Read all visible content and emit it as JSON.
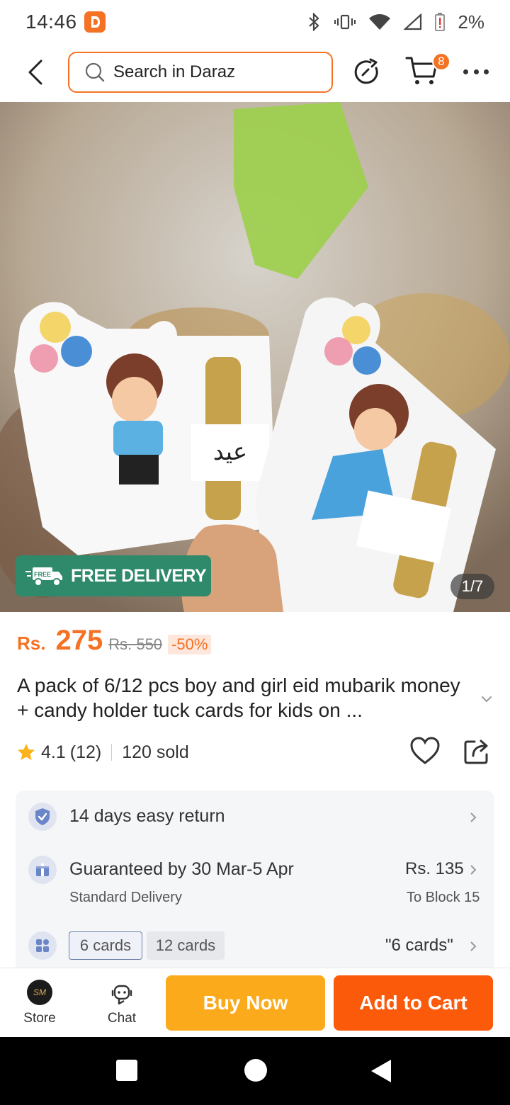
{
  "status_bar": {
    "time": "14:46",
    "battery": "2%"
  },
  "search": {
    "placeholder": "Search in Daraz"
  },
  "cart": {
    "badge_count": "8"
  },
  "product": {
    "badge": "FREE DELIVERY",
    "badge_small": "FREE",
    "image_counter": "1/7",
    "price_currency": "Rs.",
    "price": "275",
    "price_original": "Rs. 550",
    "discount": "-50%",
    "title": "A pack of 6/12 pcs  boy and  girl eid mubarik money + candy holder tuck cards for kids on ...",
    "rating": "4.1",
    "rating_count": "(12)",
    "sold": "120 sold"
  },
  "info": {
    "return_text": "14 days easy return",
    "delivery_text": "Guaranteed by 30 Mar-5 Apr",
    "delivery_sub": "Standard Delivery",
    "delivery_price": "Rs. 135",
    "delivery_location": "To Block 15",
    "variants": [
      "6 cards",
      "12 cards"
    ],
    "selected_variant": "\"6 cards\""
  },
  "action_bar": {
    "store_label": "Store",
    "chat_label": "Chat",
    "store_logo_text": "SM",
    "buy_now": "Buy Now",
    "add_to_cart": "Add to Cart"
  },
  "colors": {
    "accent": "#f57224",
    "buy_now": "#fbaa1b",
    "add_to_cart": "#fa5a0a",
    "free_delivery": "#2f8a6c"
  }
}
